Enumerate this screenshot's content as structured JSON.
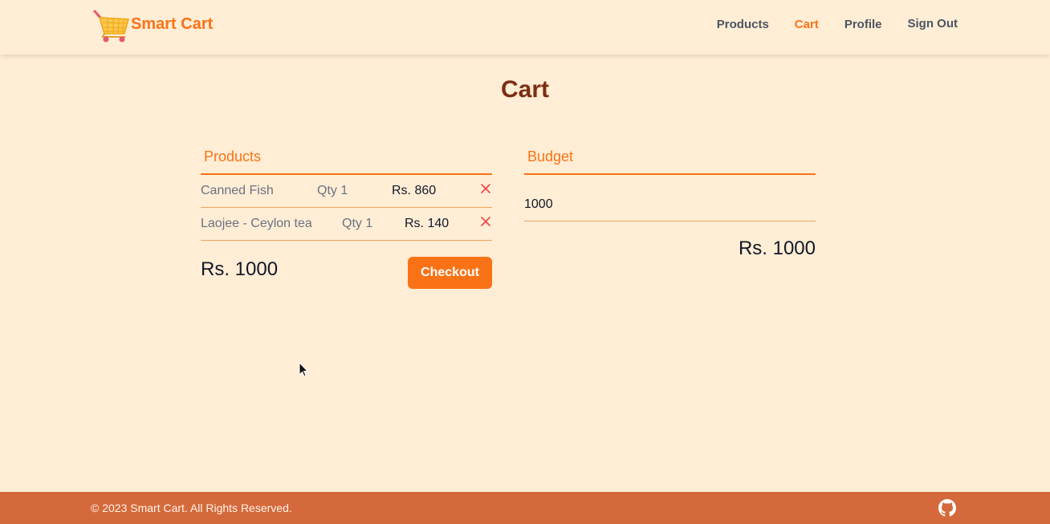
{
  "header": {
    "brand_name": "Smart Cart",
    "nav": [
      {
        "label": "Products",
        "active": false
      },
      {
        "label": "Cart",
        "active": true
      },
      {
        "label": "Profile",
        "active": false
      },
      {
        "label": "Sign Out",
        "active": false
      }
    ]
  },
  "page": {
    "title": "Cart"
  },
  "products_panel": {
    "heading": "Products",
    "items": [
      {
        "name": "Canned Fish",
        "qty": "Qty 1",
        "price": "Rs. 860"
      },
      {
        "name": "Laojee - Ceylon tea",
        "qty": "Qty 1",
        "price": "Rs. 140"
      }
    ],
    "total": "Rs. 1000",
    "checkout_label": "Checkout"
  },
  "budget_panel": {
    "heading": "Budget",
    "input_value": "1000",
    "total": "Rs. 1000"
  },
  "footer": {
    "copyright": "© 2023 Smart Cart. All Rights Reserved."
  },
  "icons": {
    "brand": "shopping-cart-icon",
    "remove": "close-icon",
    "footer": "github-icon"
  },
  "colors": {
    "accent": "#f97316",
    "title": "#7c2d12",
    "background": "#ffedd5",
    "footer": "#d46a3c",
    "remove": "#ef4444"
  }
}
